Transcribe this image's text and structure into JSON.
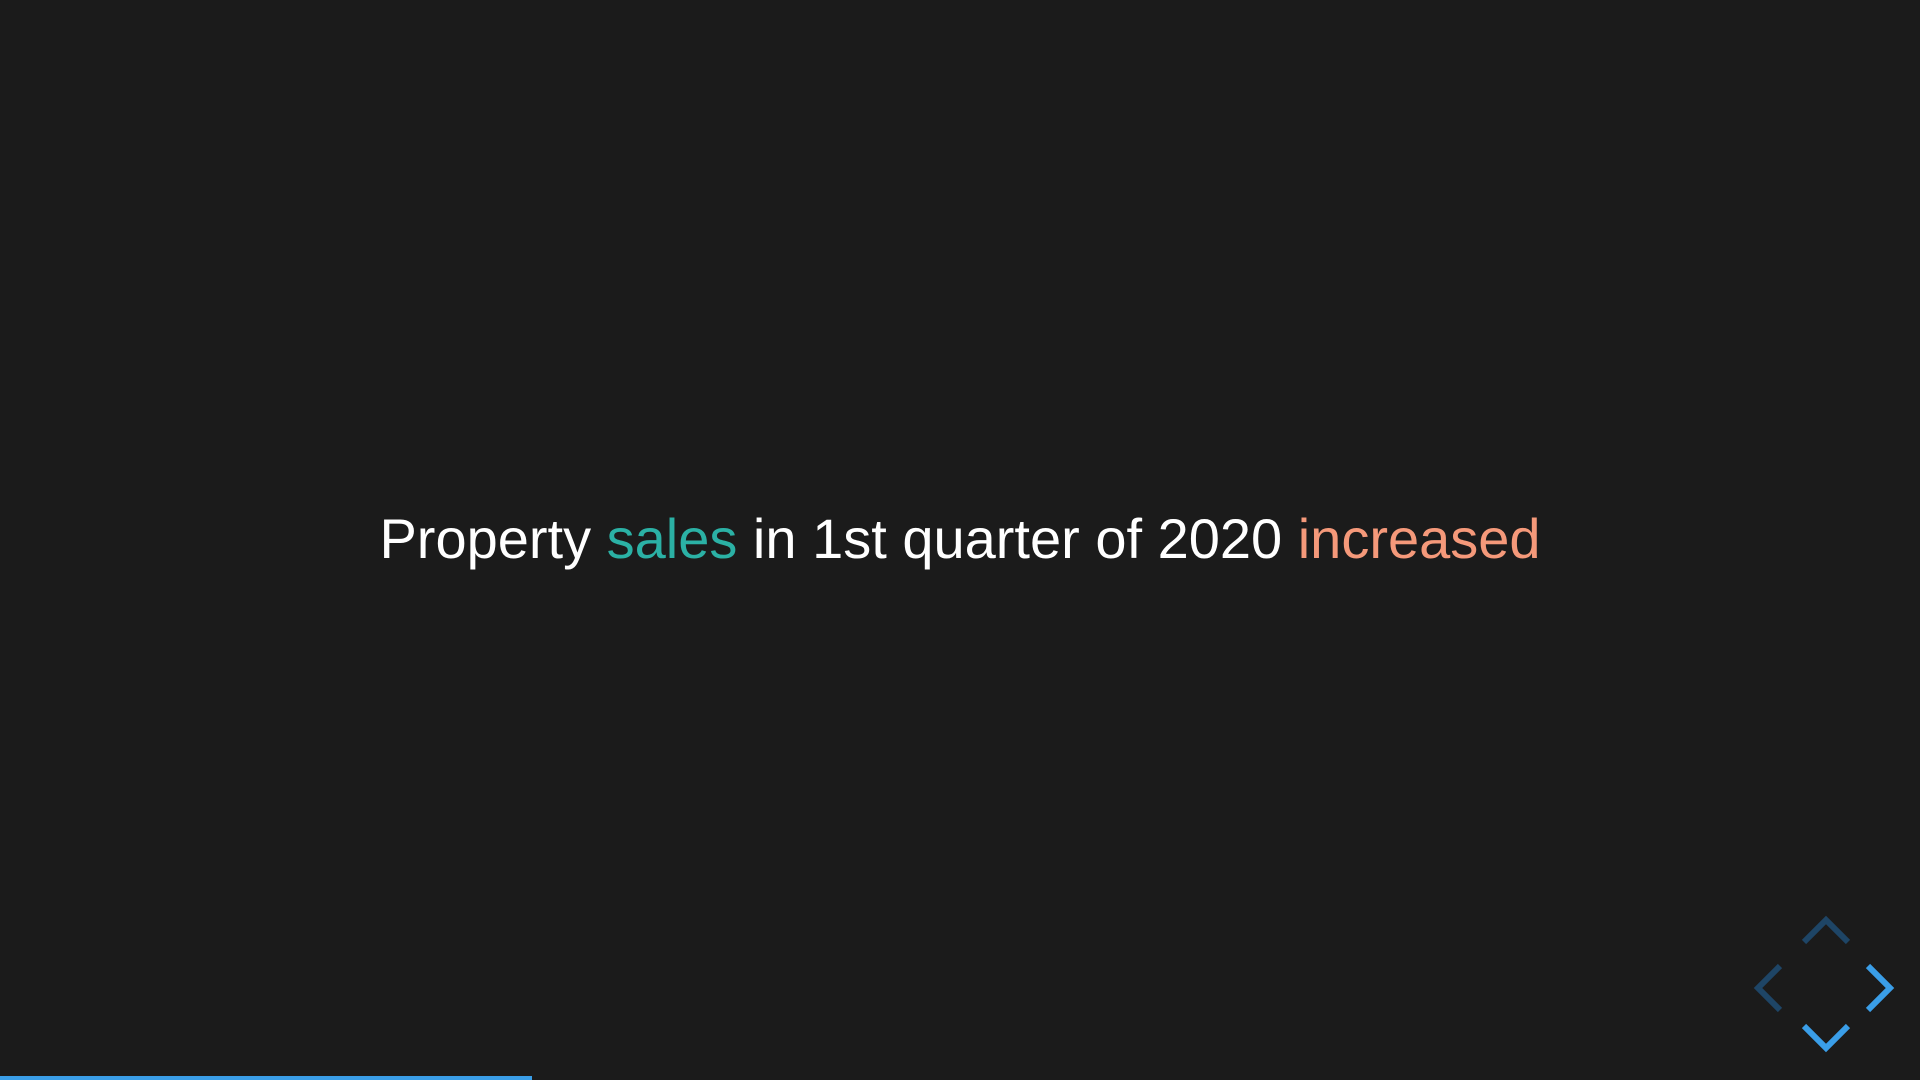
{
  "slide": {
    "headline": {
      "parts": [
        {
          "text": "Property ",
          "color": "#ffffff"
        },
        {
          "text": "sales",
          "color": "#2bb1a5"
        },
        {
          "text": " in 1st quarter of 2020 ",
          "color": "#ffffff"
        },
        {
          "text": "increased",
          "color": "#f5997a"
        }
      ]
    }
  },
  "controls": {
    "up": {
      "icon": "chevron-up-icon",
      "enabled": false
    },
    "down": {
      "icon": "chevron-down-icon",
      "enabled": true
    },
    "left": {
      "icon": "chevron-left-icon",
      "enabled": false
    },
    "right": {
      "icon": "chevron-right-icon",
      "enabled": true
    },
    "active_color": "#3a9ee8",
    "disabled_color": "#1e4566"
  },
  "progress": {
    "fraction": 0.277,
    "color": "#3a9ee8"
  },
  "background_color": "#1b1b1b"
}
